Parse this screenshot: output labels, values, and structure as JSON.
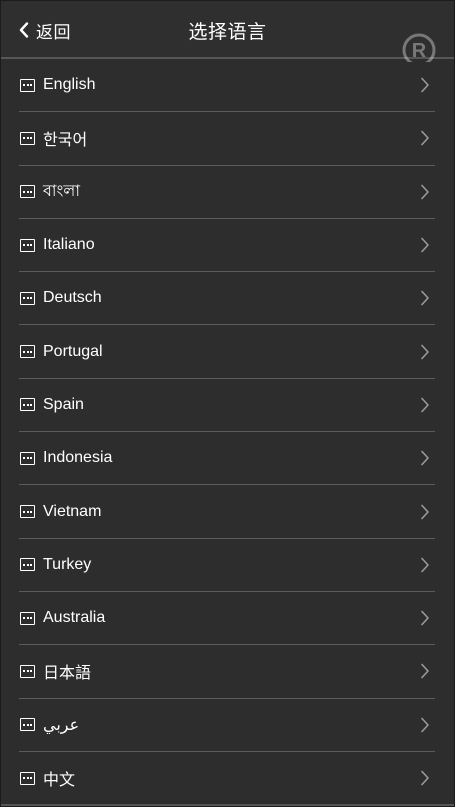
{
  "header": {
    "back_label": "返回",
    "title": "选择语言"
  },
  "languages": [
    {
      "label": "English"
    },
    {
      "label": "한국어"
    },
    {
      "label": "বাংলা"
    },
    {
      "label": "Italiano"
    },
    {
      "label": "Deutsch"
    },
    {
      "label": "Portugal"
    },
    {
      "label": "Spain"
    },
    {
      "label": "Indonesia"
    },
    {
      "label": "Vietnam"
    },
    {
      "label": "Turkey"
    },
    {
      "label": "Australia"
    },
    {
      "label": "日本語"
    },
    {
      "label": "عربي"
    },
    {
      "label": "中文"
    }
  ],
  "icons": {
    "back": "chevron-left-icon",
    "item": "keyboard-icon",
    "row_arrow": "chevron-right-icon",
    "watermark": "registered-icon"
  },
  "colors": {
    "background": "#2d2d2d",
    "text": "#ffffff",
    "divider": "#5c5c5c",
    "chevron": "#9a9a9a"
  }
}
